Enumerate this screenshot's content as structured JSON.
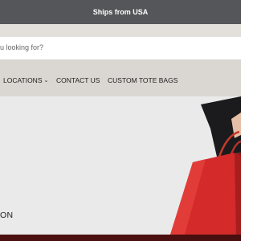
{
  "announcement": {
    "text": "Ships from USA"
  },
  "search": {
    "placeholder": "u looking for?"
  },
  "nav": {
    "items": [
      {
        "label": "LOCATIONS",
        "has_dropdown": true
      },
      {
        "label": "CONTACT US",
        "has_dropdown": false
      },
      {
        "label": "CUSTOM TOTE BAGS",
        "has_dropdown": false
      }
    ]
  },
  "hero": {
    "text": "ON"
  },
  "colors": {
    "topbar": "#555659",
    "nav_bg": "#dad6d1",
    "hero_bg": "#eaeaea",
    "bag_red": "#d42a2a"
  }
}
